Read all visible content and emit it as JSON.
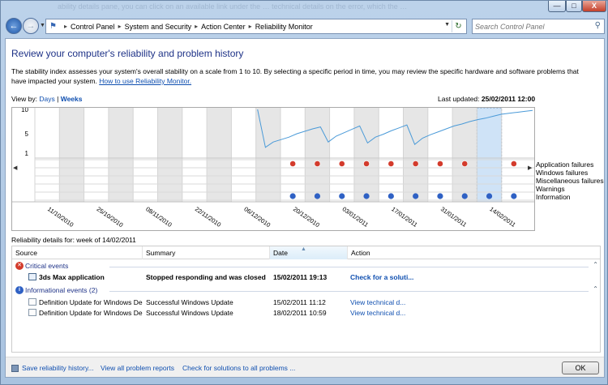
{
  "titlebar": {
    "background_text": "ability details pane, you can click on an available link under the … technical details on the error, which the …",
    "minimize": "—",
    "maximize": "□",
    "close": "X"
  },
  "nav": {
    "breadcrumbs": [
      "Control Panel",
      "System and Security",
      "Action Center",
      "Reliability Monitor"
    ],
    "search_placeholder": "Search Control Panel"
  },
  "page": {
    "title": "Review your computer's reliability and problem history",
    "description": "The stability index assesses your system's overall stability on a scale from 1 to 10. By selecting a specific period in time, you may review the specific hardware and software problems that have impacted your system.",
    "how_to_link": "How to use Reliability Monitor.",
    "view_by_label": "View by:",
    "view_days": "Days",
    "view_sep": "|",
    "view_weeks": "Weeks",
    "last_updated_label": "Last updated:",
    "last_updated_value": "25/02/2011 12:00"
  },
  "chart_data": {
    "type": "line",
    "title": "",
    "ylim": [
      1,
      10
    ],
    "y_ticks": [
      "10",
      "5",
      "1"
    ],
    "x_labels": [
      "11/10/2010",
      "25/10/2010",
      "08/11/2010",
      "22/11/2010",
      "06/12/2010",
      "20/12/2010",
      "03/01/2011",
      "17/01/2011",
      "31/01/2011",
      "14/02/2011"
    ],
    "columns": 20,
    "shaded_columns": [
      1,
      3,
      5,
      7,
      9,
      11,
      13,
      15,
      17
    ],
    "selected_column": 18,
    "stability_start_column": 9,
    "stability_series": [
      10,
      2.2,
      3.3,
      3.8,
      4.3,
      5.0,
      5.5,
      6.0,
      6.4,
      3.3,
      4.5,
      5.2,
      5.9,
      6.6,
      3.1,
      4.3,
      4.9,
      5.6,
      6.2,
      6.8,
      2.8,
      4.1,
      4.8,
      5.4,
      6.0,
      6.6,
      7.0,
      7.5,
      7.9,
      8.2,
      8.6,
      9.0,
      9.2,
      9.4,
      9.6,
      9.8
    ],
    "rows": [
      "Application failures",
      "Windows failures",
      "Miscellaneous failures",
      "Warnings",
      "Information"
    ],
    "application_failure_columns": [
      10,
      11,
      12,
      13,
      14,
      15,
      16,
      17,
      19
    ],
    "information_columns": [
      10,
      11,
      12,
      13,
      14,
      15,
      16,
      17,
      18,
      19,
      20
    ]
  },
  "details": {
    "label": "Reliability details for: week of 14/02/2011",
    "columns": [
      "Source",
      "Summary",
      "Date",
      "Action"
    ],
    "critical_group": "Critical events",
    "info_group": "Informational events (2)",
    "critical_rows": [
      {
        "source": "3ds Max application",
        "summary": "Stopped responding and was closed",
        "date": "15/02/2011 19:13",
        "action": "Check for a soluti..."
      }
    ],
    "info_rows": [
      {
        "source": "Definition Update for Windows De...",
        "summary": "Successful Windows Update",
        "date": "15/02/2011 11:12",
        "action": "View  technical d..."
      },
      {
        "source": "Definition Update for Windows De...",
        "summary": "Successful Windows Update",
        "date": "18/02/2011 10:59",
        "action": "View  technical d..."
      }
    ]
  },
  "footer": {
    "save_link": "Save reliability history...",
    "view_all_link": "View all problem reports",
    "check_link": "Check for solutions to all problems ...",
    "ok_label": "OK"
  },
  "colors": {
    "title_blue": "#1e3287",
    "link_blue": "#0f4fb0",
    "line_blue": "#4a9ad8",
    "selected_column": "#cfe3f7",
    "shaded_column": "#e6e6e6",
    "error_red": "#d33b2c",
    "info_blue": "#2f61c4"
  }
}
